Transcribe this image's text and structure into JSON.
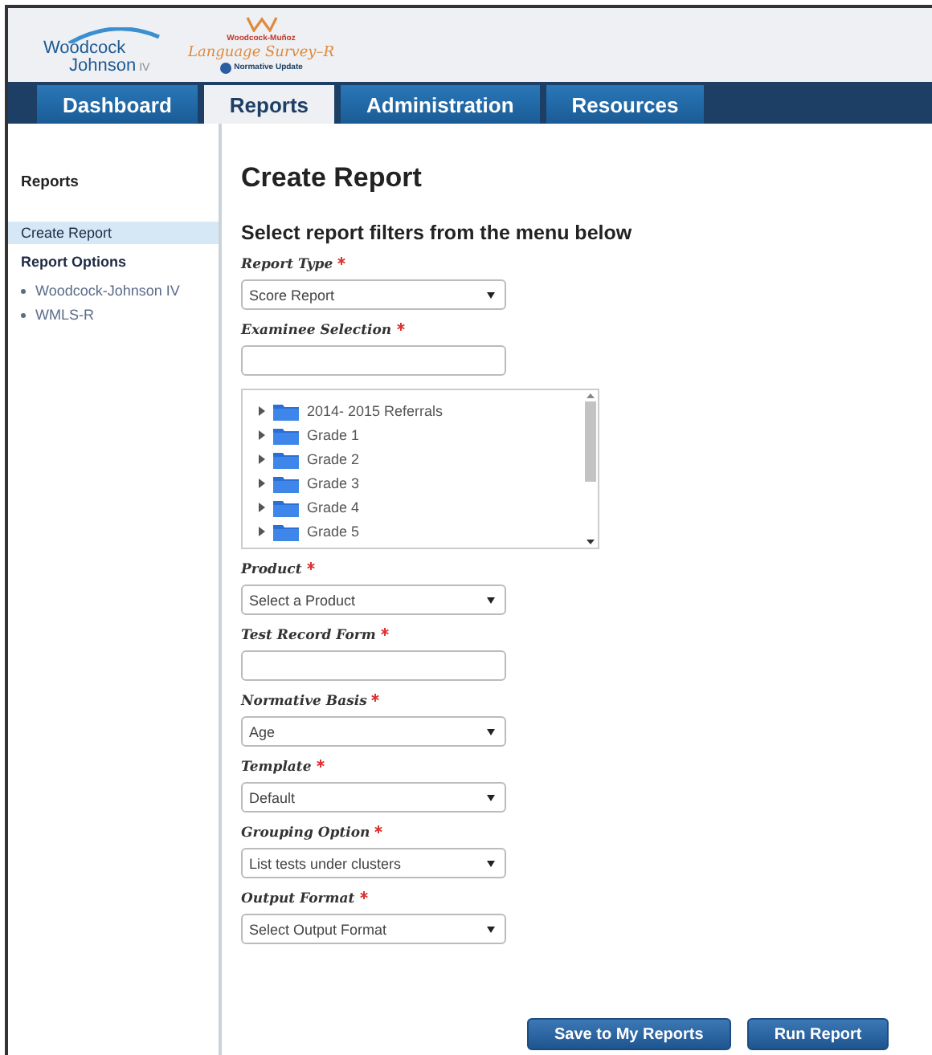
{
  "header": {
    "logo_primary": {
      "line1": "Woodcock",
      "line2": "Johnson",
      "suffix": "IV"
    },
    "logo_secondary": {
      "brand": "Woodcock-Muñoz",
      "title": "Language Survey–R",
      "badge": "Normative Update"
    }
  },
  "nav": [
    {
      "label": "Dashboard",
      "selected": false
    },
    {
      "label": "Reports",
      "selected": true
    },
    {
      "label": "Administration",
      "selected": false
    },
    {
      "label": "Resources",
      "selected": false
    }
  ],
  "sidebar": {
    "title": "Reports",
    "items": [
      {
        "label": "Create Report",
        "kind": "link",
        "selected": true
      },
      {
        "label": "Report Options",
        "kind": "heading",
        "selected": false
      },
      {
        "label": "Woodcock-Johnson IV",
        "kind": "bullet",
        "selected": false
      },
      {
        "label": "WMLS-R",
        "kind": "bullet",
        "selected": false
      }
    ]
  },
  "main": {
    "title": "Create Report",
    "subtitle": "Select report filters from the menu below",
    "fields": [
      {
        "label": "Report Type",
        "required": true,
        "kind": "select",
        "value": "Score Report"
      },
      {
        "label": "Examinee Selection",
        "required": true,
        "kind": "text"
      },
      {
        "kind": "tree",
        "items": [
          {
            "label": "2014- 2015 Referrals",
            "expanded": false
          },
          {
            "label": "Grade 1",
            "expanded": false
          },
          {
            "label": "Grade 2",
            "expanded": false
          },
          {
            "label": "Grade 3",
            "expanded": false
          },
          {
            "label": "Grade 4",
            "expanded": false
          },
          {
            "label": "Grade 5",
            "expanded": false
          }
        ]
      },
      {
        "label": "Product",
        "required": true,
        "kind": "select",
        "value": "Select a Product"
      },
      {
        "label": "Test Record Form",
        "required": true,
        "kind": "text"
      },
      {
        "label": "Normative Basis",
        "required": true,
        "kind": "select",
        "value": "Age"
      },
      {
        "label": "Template",
        "required": true,
        "kind": "select",
        "value": "Default"
      },
      {
        "label": "Grouping Option",
        "required": true,
        "kind": "select",
        "value": "List tests under clusters"
      },
      {
        "label": "Output Format",
        "required": true,
        "kind": "select",
        "value": "Select Output Format"
      }
    ],
    "buttons": [
      "Save to My Reports",
      "Run Report"
    ]
  }
}
